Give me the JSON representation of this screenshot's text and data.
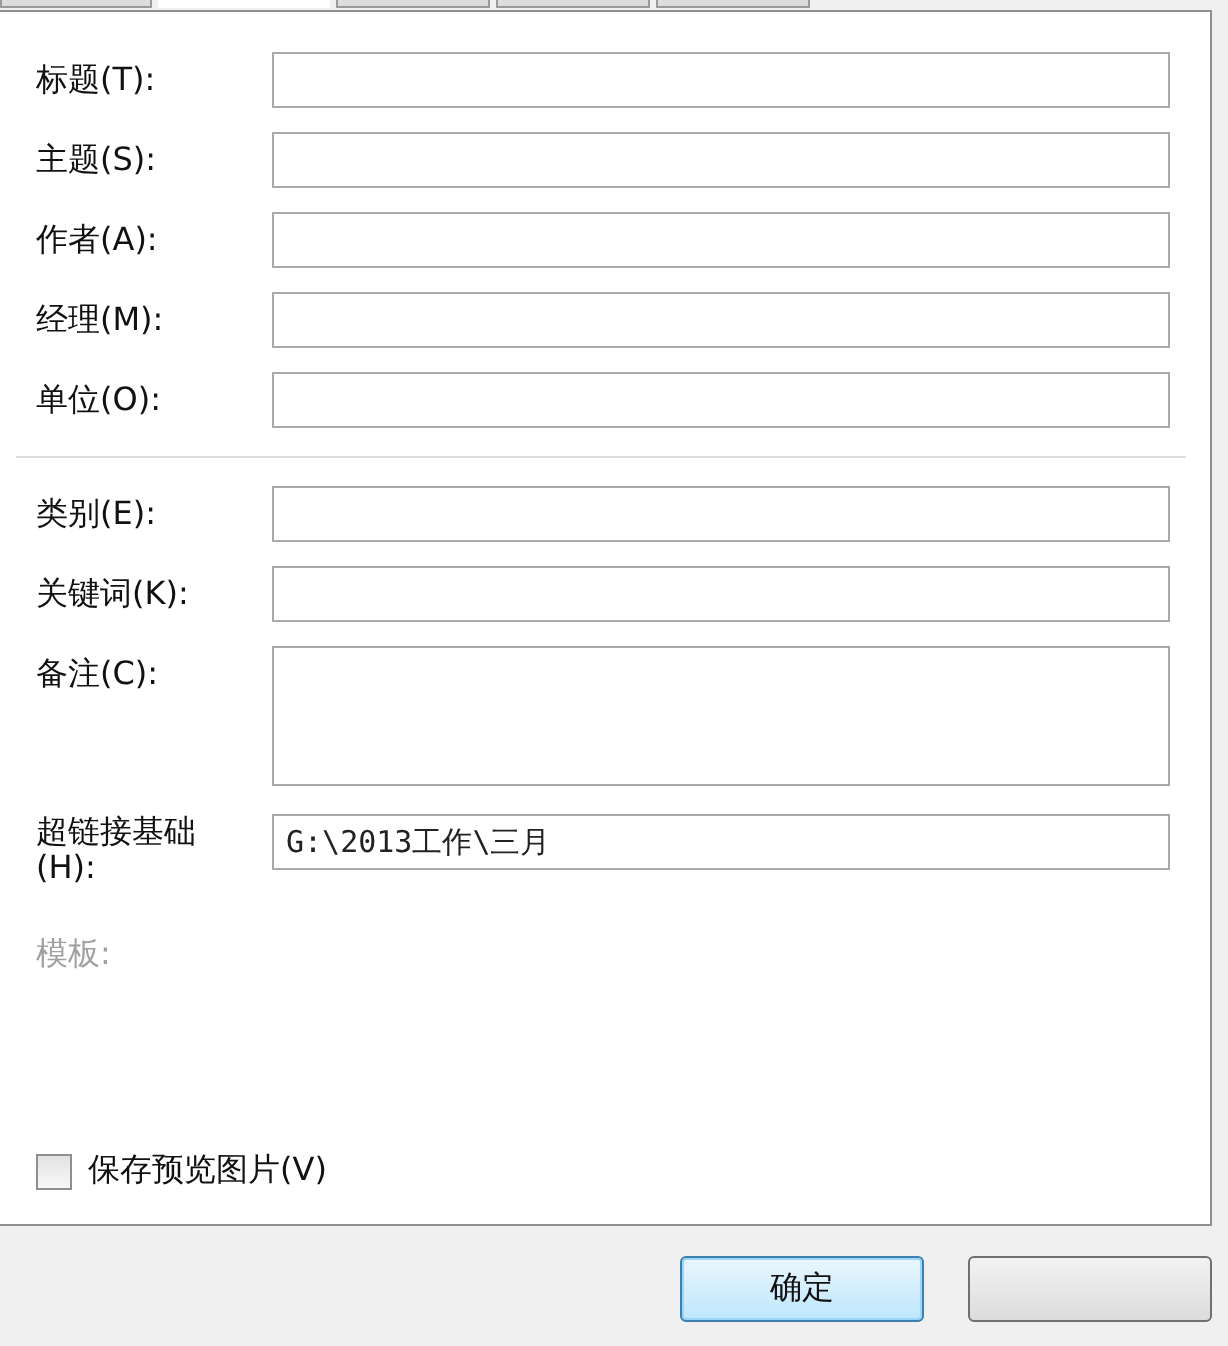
{
  "tabs": [
    {
      "selected": false
    },
    {
      "selected": true
    },
    {
      "selected": false
    },
    {
      "selected": false
    },
    {
      "selected": false
    }
  ],
  "fields": [
    {
      "label": "标题(T):",
      "kind": "line"
    },
    {
      "label": "主题(S):",
      "kind": "line"
    },
    {
      "label": "作者(A):",
      "kind": "line"
    },
    {
      "label": "经理(M):",
      "kind": "line"
    },
    {
      "label": "单位(O):",
      "kind": "line"
    },
    {
      "kind": "separator"
    },
    {
      "label": "类别(E):",
      "kind": "line"
    },
    {
      "label": "关键词(K):",
      "kind": "line"
    },
    {
      "label": "备注(C):",
      "kind": "area"
    },
    {
      "label": "超链接基础(H):",
      "kind": "line",
      "value": "G:\\2013工作\\三月"
    },
    {
      "label": "模板:",
      "kind": "static",
      "disabled": true
    }
  ],
  "checkbox": {
    "label": "保存预览图片(V)",
    "checked": false
  },
  "buttons": [
    {
      "label": "确定",
      "default": true
    },
    {
      "default": false
    }
  ]
}
